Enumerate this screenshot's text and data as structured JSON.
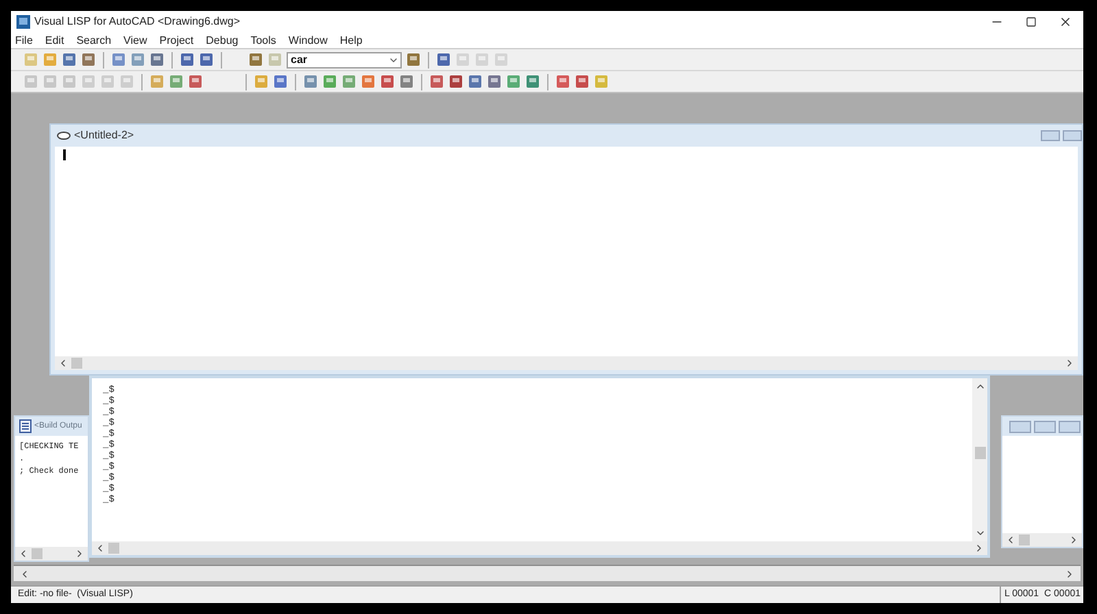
{
  "window": {
    "title": "Visual LISP for AutoCAD <Drawing6.dwg>"
  },
  "menu": [
    "File",
    "Edit",
    "Search",
    "View",
    "Project",
    "Debug",
    "Tools",
    "Window",
    "Help"
  ],
  "search": {
    "value": "car"
  },
  "editor": {
    "title": "<Untitled-2>"
  },
  "console": {
    "lines": [
      "_$",
      "_$",
      "_$",
      "_$",
      "_$",
      "_$",
      "_$",
      "_$",
      "_$",
      "_$",
      "_$"
    ]
  },
  "build_output": {
    "title": "<Build Outpu",
    "lines": [
      "[CHECKING TE",
      ".",
      "; Check done"
    ]
  },
  "status_bar": {
    "mode": "Edit: -no file-  (Visual LISP)",
    "line": "L 00001",
    "column": "C 00001"
  }
}
